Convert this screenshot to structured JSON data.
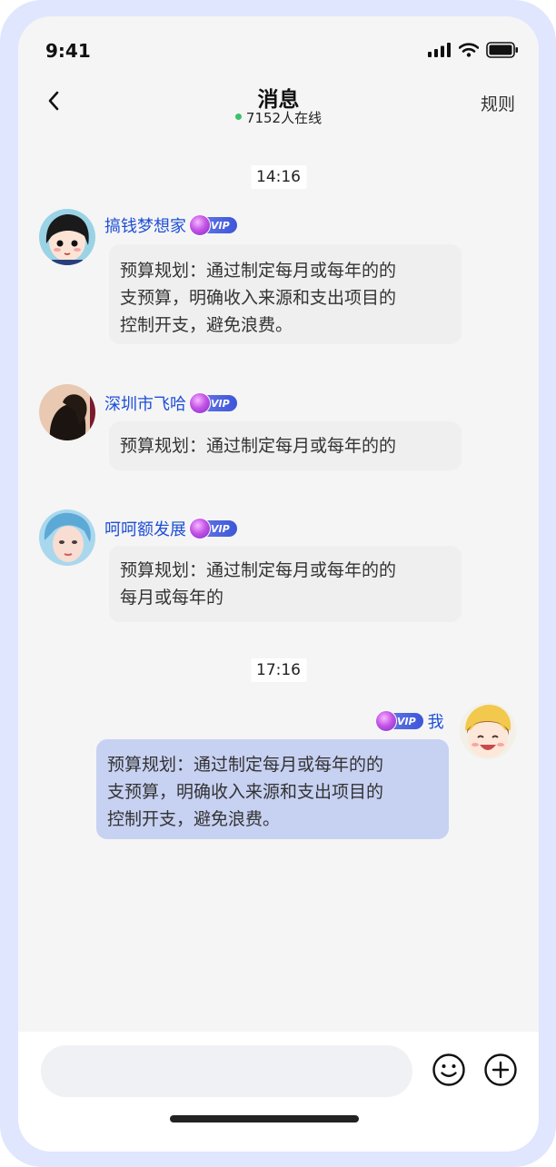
{
  "status_bar": {
    "time": "9:41"
  },
  "header": {
    "title": "消息",
    "online_text": "7152人在线",
    "rules_label": "规则"
  },
  "colors": {
    "accent": "#1e4fd6",
    "online": "#3cc16c",
    "my_bubble": "#c7d1f2",
    "frame": "#dfe6fd"
  },
  "timestamps": [
    "14:16",
    "17:16"
  ],
  "messages": [
    {
      "name": "搞钱梦想家",
      "badge": "VIP",
      "lines": [
        "预算规划：通过制定每月或每年的的",
        "支预算，明确收入来源和支出项目的",
        "控制开支，避免浪费。"
      ]
    },
    {
      "name": "深圳市飞哈",
      "badge": "VIP",
      "lines": [
        "预算规划：通过制定每月或每年的的"
      ]
    },
    {
      "name": "呵呵额发展",
      "badge": "VIP",
      "lines": [
        "预算规划：通过制定每月或每年的的",
        "每月或每年的"
      ]
    },
    {
      "name": "我",
      "badge": "VIP",
      "lines": [
        "预算规划：通过制定每月或每年的的",
        "支预算，明确收入来源和支出项目的",
        "控制开支，避免浪费。"
      ]
    }
  ],
  "input": {
    "placeholder": ""
  },
  "icons": [
    "back-icon",
    "signal-icon",
    "wifi-icon",
    "battery-icon",
    "emoji-icon",
    "plus-icon"
  ]
}
